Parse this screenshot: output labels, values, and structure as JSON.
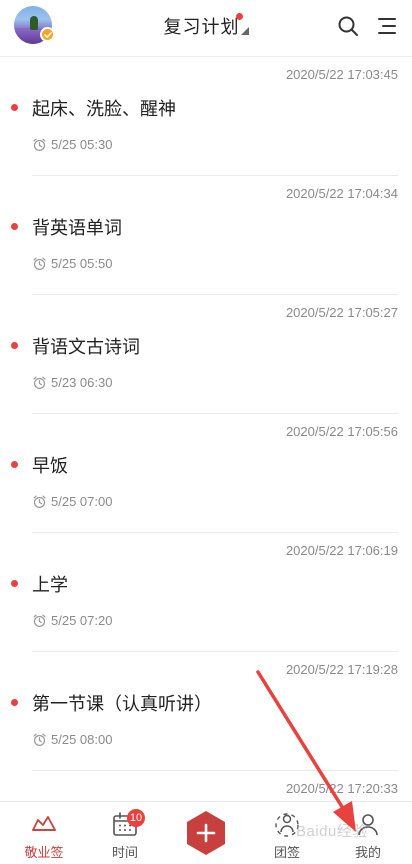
{
  "header": {
    "title": "复习计划"
  },
  "items": [
    {
      "created": "2020/5/22 17:03:45",
      "title": "起床、洗脸、醒神",
      "reminder": "5/25 05:30"
    },
    {
      "created": "2020/5/22 17:04:34",
      "title": "背英语单词",
      "reminder": "5/25 05:50"
    },
    {
      "created": "2020/5/22 17:05:27",
      "title": "背语文古诗词",
      "reminder": "5/23 06:30"
    },
    {
      "created": "2020/5/22 17:05:56",
      "title": "早饭",
      "reminder": "5/25 07:00"
    },
    {
      "created": "2020/5/22 17:06:19",
      "title": "上学",
      "reminder": "5/25 07:20"
    },
    {
      "created": "2020/5/22 17:19:28",
      "title": "第一节课（认真听讲）",
      "reminder": "5/25 08:00"
    },
    {
      "created": "2020/5/22 17:20:33",
      "title": "",
      "reminder": ""
    }
  ],
  "nav": {
    "items": [
      {
        "label": "敬业签",
        "icon": "jingyeqian-icon",
        "active": true
      },
      {
        "label": "时间",
        "icon": "calendar-icon",
        "badge": "10"
      },
      {
        "label": "团签",
        "icon": "team-icon"
      },
      {
        "label": "我的",
        "icon": "user-icon"
      }
    ],
    "add_icon": "plus-icon"
  },
  "watermark": "Baidu经验",
  "colors": {
    "accent": "#e8413e",
    "fab": "#c8403e",
    "text_primary": "#222222",
    "text_secondary": "#8a8a8a"
  }
}
